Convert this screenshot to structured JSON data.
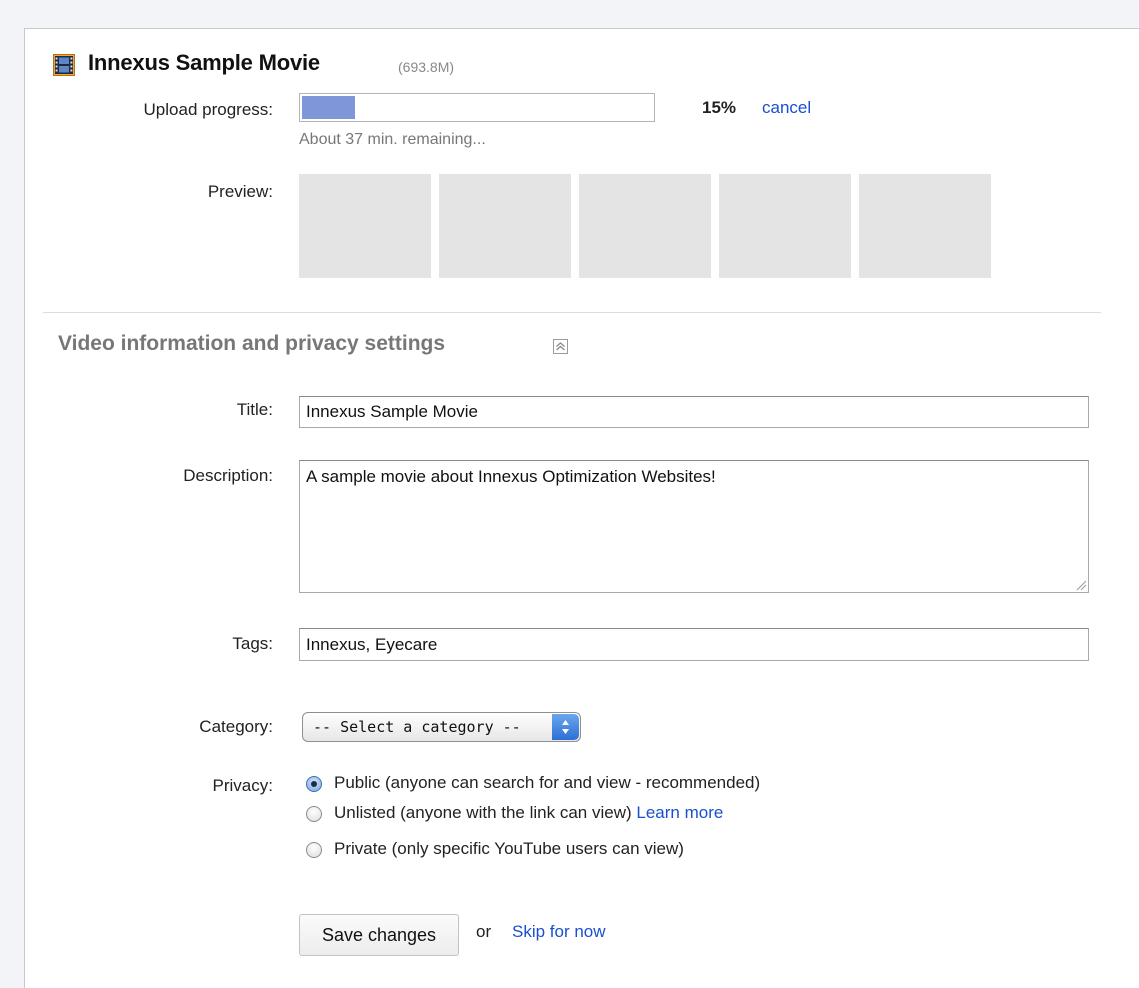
{
  "header": {
    "movie_title": "Innexus Sample Movie",
    "file_size": "(693.8M)"
  },
  "upload": {
    "label": "Upload progress:",
    "percent_text": "15%",
    "progress_fraction": 0.15,
    "cancel_label": "cancel",
    "remaining_text": "About 37 min. remaining..."
  },
  "preview": {
    "label": "Preview:",
    "thumbnail_count": 5
  },
  "section": {
    "title": "Video information and privacy settings"
  },
  "form": {
    "title_label": "Title:",
    "title_value": "Innexus Sample Movie",
    "description_label": "Description:",
    "description_value": "A sample movie about Innexus Optimization Websites!",
    "tags_label": "Tags:",
    "tags_value": "Innexus, Eyecare",
    "category_label": "Category:",
    "category_selected": "-- Select a category --",
    "privacy_label": "Privacy:",
    "privacy_options": [
      {
        "label": "Public (anyone can search for and view - recommended)",
        "checked": true
      },
      {
        "label": "Unlisted (anyone with the link can view)",
        "checked": false,
        "link": "Learn more"
      },
      {
        "label": "Private (only specific YouTube users can view)",
        "checked": false
      }
    ]
  },
  "actions": {
    "save_label": "Save changes",
    "or_text": "or",
    "skip_label": "Skip for now"
  },
  "colors": {
    "link": "#1a4fd0",
    "progress_fill": "#7f97d9",
    "thumb_placeholder": "#e4e4e4",
    "section_title": "#777777"
  }
}
